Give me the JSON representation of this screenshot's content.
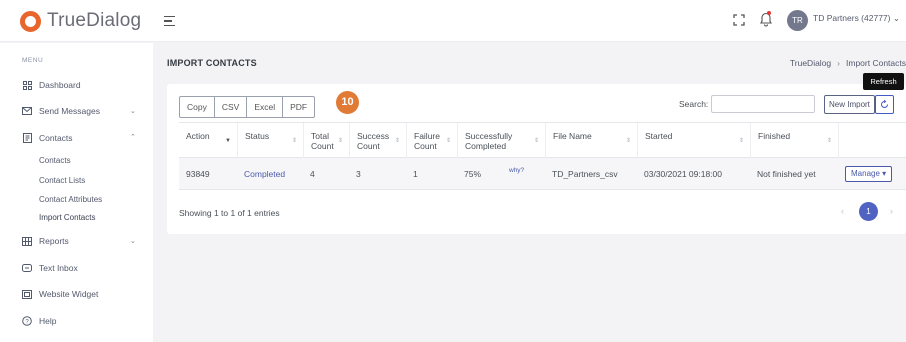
{
  "brand": {
    "name": "TrueDialog"
  },
  "topbar": {
    "avatar_initials": "TR",
    "user_name": "TD Partners (42777) ⌄"
  },
  "sidebar": {
    "menu_title": "MENU",
    "items": [
      {
        "label": "Dashboard",
        "icon": "dashboard-icon"
      },
      {
        "label": "Send Messages",
        "icon": "envelope-icon"
      },
      {
        "label": "Contacts",
        "icon": "contacts-icon"
      },
      {
        "label": "Reports",
        "icon": "grid-icon"
      },
      {
        "label": "Text Inbox",
        "icon": "chat-icon"
      },
      {
        "label": "Website Widget",
        "icon": "widget-icon"
      },
      {
        "label": "Help",
        "icon": "help-icon"
      }
    ],
    "contacts_sub": [
      {
        "label": "Contacts"
      },
      {
        "label": "Contact Lists"
      },
      {
        "label": "Contact Attributes"
      },
      {
        "label": "Import Contacts"
      }
    ]
  },
  "page": {
    "title": "IMPORT CONTACTS",
    "breadcrumb": [
      "TrueDialog",
      "Import Contacts"
    ]
  },
  "toolbar": {
    "export_buttons": [
      "Copy",
      "CSV",
      "Excel",
      "PDF"
    ],
    "step_badge": "10",
    "search_label": "Search:",
    "search_value": "",
    "new_import_label": "New Import",
    "refresh_tooltip": "Refresh"
  },
  "table": {
    "columns": [
      "Action",
      "Status",
      "Total Count",
      "Success Count",
      "Failure Count",
      "Successfully Completed",
      "File Name",
      "Started",
      "Finished"
    ],
    "rows": [
      {
        "action": "93849",
        "status": "Completed",
        "total": "4",
        "success": "3",
        "failure": "1",
        "completed_pct": "75%",
        "why": "why?",
        "file_name": "TD_Partners_csv",
        "started": "03/30/2021 09:18:00",
        "finished": "Not finished yet",
        "manage_label": "Manage ▾"
      }
    ]
  },
  "footer": {
    "info": "Showing 1 to 1 of 1 entries",
    "current_page": "1",
    "prev": "‹",
    "next": "›"
  },
  "colors": {
    "brand_orange": "#e8652d",
    "accent_blue": "#5163c2",
    "badge_orange": "#e07a35"
  }
}
